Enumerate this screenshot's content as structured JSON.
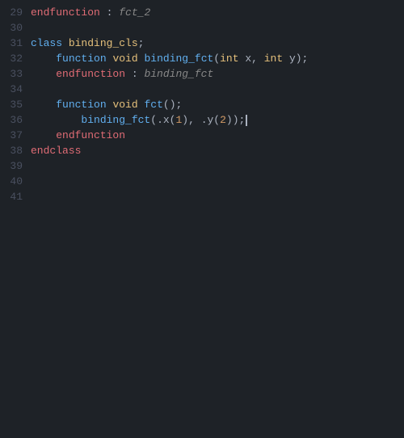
{
  "editor": {
    "background": "#1e2227",
    "lines": [
      {
        "number": "29",
        "content": "endfunction_fct2"
      },
      {
        "number": "30",
        "content": ""
      },
      {
        "number": "31",
        "content": "class_binding_cls"
      },
      {
        "number": "32",
        "content": "    function_binding_fct"
      },
      {
        "number": "33",
        "content": "    endfunction_binding_fct"
      },
      {
        "number": "34",
        "content": ""
      },
      {
        "number": "35",
        "content": "    function_void_fct"
      },
      {
        "number": "36",
        "content": "        binding_fct_call"
      },
      {
        "number": "37",
        "content": "    endfunction"
      },
      {
        "number": "38",
        "content": "endclass"
      },
      {
        "number": "39",
        "content": ""
      },
      {
        "number": "40",
        "content": ""
      },
      {
        "number": "41",
        "content": ""
      }
    ]
  }
}
